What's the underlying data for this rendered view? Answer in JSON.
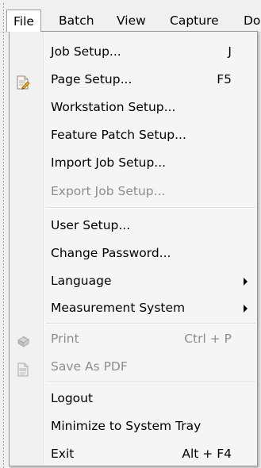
{
  "menubar": {
    "items": [
      {
        "label": "File"
      },
      {
        "label": "Batch"
      },
      {
        "label": "View"
      },
      {
        "label": "Capture"
      },
      {
        "label": "Do"
      }
    ]
  },
  "file_menu": {
    "items": [
      {
        "label": "Job Setup...",
        "shortcut": "J"
      },
      {
        "label": "Page Setup...",
        "shortcut": "F5",
        "icon": "page-setup-icon"
      },
      {
        "label": "Workstation Setup..."
      },
      {
        "label": "Feature Patch Setup..."
      },
      {
        "label": "Import Job Setup..."
      },
      {
        "label": "Export Job Setup..."
      },
      {
        "label": "User Setup..."
      },
      {
        "label": "Change Password..."
      },
      {
        "label": "Language"
      },
      {
        "label": "Measurement System"
      },
      {
        "label": "Print",
        "shortcut": "Ctrl + P",
        "icon": "printer-icon"
      },
      {
        "label": "Save As PDF",
        "icon": "pdf-icon"
      },
      {
        "label": "Logout"
      },
      {
        "label": "Minimize to System Tray"
      },
      {
        "label": "Exit",
        "shortcut": "Alt + F4"
      }
    ]
  }
}
